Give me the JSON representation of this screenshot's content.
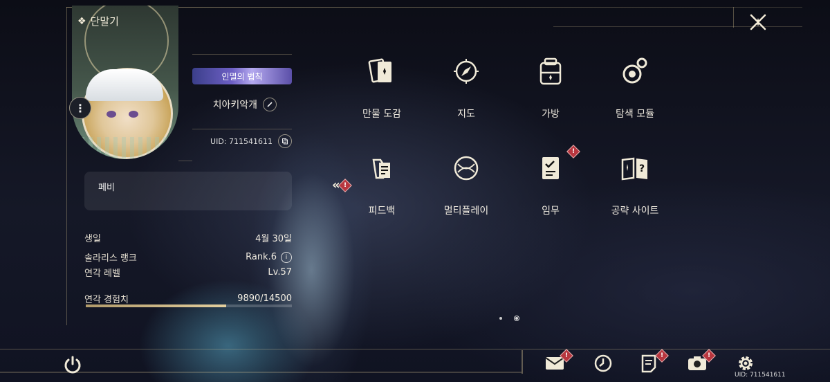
{
  "header": {
    "title": "단말기"
  },
  "profile": {
    "title_badge": "인멸의 법칙",
    "nickname": "치아키악개",
    "uid": "UID: 711541611",
    "bio": "페비"
  },
  "stats": [
    {
      "label": "생일",
      "value": "4월 30일"
    },
    {
      "label": "솔라리스 랭크",
      "value": "Rank.6"
    },
    {
      "label": "연각 레벨",
      "value": "Lv.57"
    },
    {
      "label": "연각 경험치",
      "value": "9890/14500"
    }
  ],
  "exp_progress": 0.682,
  "menu": [
    {
      "label": "만물 도감",
      "icon": "cards-icon",
      "alert": false
    },
    {
      "label": "지도",
      "icon": "compass-icon",
      "alert": false
    },
    {
      "label": "가방",
      "icon": "backpack-icon",
      "alert": false
    },
    {
      "label": "탐색 모듈",
      "icon": "explore-module-icon",
      "alert": false
    },
    {
      "label": "피드백",
      "icon": "feedback-icon",
      "alert": false
    },
    {
      "label": "멀티플레이",
      "icon": "multiplayer-icon",
      "alert": false
    },
    {
      "label": "임무",
      "icon": "quest-icon",
      "alert": true
    },
    {
      "label": "공략 사이트",
      "icon": "guide-book-icon",
      "alert": false
    }
  ],
  "alert_symbol": "!",
  "bottom": {
    "uid": "UID: 711541611"
  },
  "colors": {
    "accent": "#e3cf9e",
    "alert": "#b8363f",
    "badge": "#6d5fc4"
  }
}
